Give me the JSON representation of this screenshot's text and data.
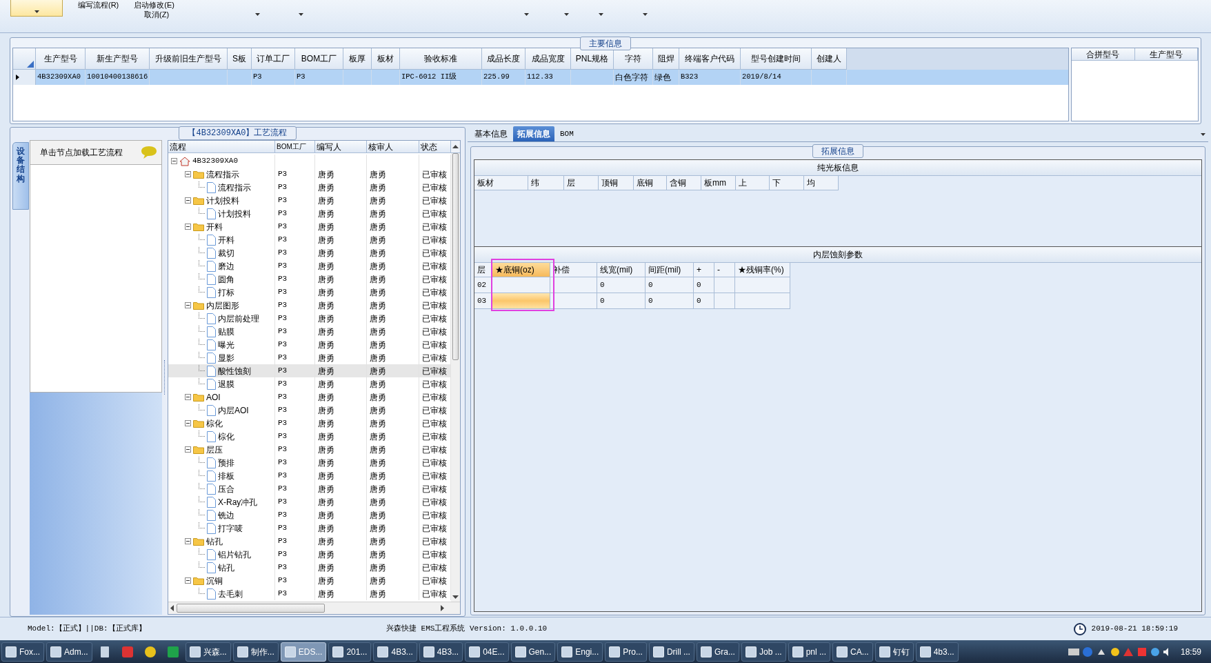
{
  "ribbon": {
    "commands": [
      "编写流程(R)",
      "启动修改(E)",
      "取消(Z)"
    ]
  },
  "main_info": {
    "title": "主要信息",
    "table": {
      "columns": [
        "生产型号",
        "新生产型号",
        "升级前旧生产型号",
        "S板",
        "订单工厂",
        "BOM工厂",
        "板厚",
        "板材",
        "验收标准",
        "成品长度",
        "成品宽度",
        "PNL规格",
        "字符",
        "阻焊",
        "终端客户代码",
        "型号创建时间",
        "创建人"
      ],
      "rows": [
        {
          "selected": true,
          "cells": [
            "4B32309XA0",
            "10010400138616",
            null,
            null,
            "P3",
            "P3",
            null,
            null,
            "IPC-6012 II级",
            "225.99",
            "112.33",
            null,
            "白色字符",
            "绿色",
            "B323",
            "2019/8/14",
            null
          ]
        }
      ]
    },
    "side_table": {
      "columns": [
        "合拼型号",
        "生产型号"
      ]
    }
  },
  "process_panel": {
    "title": "【4B32309XA0】工艺流程",
    "side_tab": "设备结构",
    "hint": "单击节点加载工艺流程",
    "columns": [
      "流程",
      "BOM工厂",
      "编写人",
      "核审人",
      "状态"
    ],
    "tree": {
      "label": "4B32309XA0",
      "kind": "root",
      "expanded": true,
      "selected": false,
      "children": [
        {
          "label": "流程指示",
          "kind": "folder",
          "bom": "P3",
          "writer": "唐勇",
          "reviewer": "唐勇",
          "status": "已审核",
          "expanded": true,
          "selected": false,
          "children": [
            {
              "label": "流程指示",
              "kind": "file",
              "bom": "P3",
              "writer": "唐勇",
              "reviewer": "唐勇",
              "status": "已审核",
              "selected": false
            }
          ]
        },
        {
          "label": "计划投料",
          "kind": "folder",
          "bom": "P3",
          "writer": "唐勇",
          "reviewer": "唐勇",
          "status": "已审核",
          "expanded": true,
          "selected": false,
          "children": [
            {
              "label": "计划投料",
              "kind": "file",
              "bom": "P3",
              "writer": "唐勇",
              "reviewer": "唐勇",
              "status": "已审核",
              "selected": false
            }
          ]
        },
        {
          "label": "开料",
          "kind": "folder",
          "bom": "P3",
          "writer": "唐勇",
          "reviewer": "唐勇",
          "status": "已审核",
          "expanded": true,
          "selected": false,
          "children": [
            {
              "label": "开料",
              "kind": "file",
              "bom": "P3",
              "writer": "唐勇",
              "reviewer": "唐勇",
              "status": "已审核",
              "selected": false
            },
            {
              "label": "裁切",
              "kind": "file",
              "bom": "P3",
              "writer": "唐勇",
              "reviewer": "唐勇",
              "status": "已审核",
              "selected": false
            },
            {
              "label": "磨边",
              "kind": "file",
              "bom": "P3",
              "writer": "唐勇",
              "reviewer": "唐勇",
              "status": "已审核",
              "selected": false
            },
            {
              "label": "圆角",
              "kind": "file",
              "bom": "P3",
              "writer": "唐勇",
              "reviewer": "唐勇",
              "status": "已审核",
              "selected": false
            },
            {
              "label": "打标",
              "kind": "file",
              "bom": "P3",
              "writer": "唐勇",
              "reviewer": "唐勇",
              "status": "已审核",
              "selected": false
            }
          ]
        },
        {
          "label": "内层图形",
          "kind": "folder",
          "bom": "P3",
          "writer": "唐勇",
          "reviewer": "唐勇",
          "status": "已审核",
          "expanded": true,
          "selected": false,
          "children": [
            {
              "label": "内层前处理",
              "kind": "file",
              "bom": "P3",
              "writer": "唐勇",
              "reviewer": "唐勇",
              "status": "已审核",
              "selected": false
            },
            {
              "label": "贴膜",
              "kind": "file",
              "bom": "P3",
              "writer": "唐勇",
              "reviewer": "唐勇",
              "status": "已审核",
              "selected": false
            },
            {
              "label": "曝光",
              "kind": "file",
              "bom": "P3",
              "writer": "唐勇",
              "reviewer": "唐勇",
              "status": "已审核",
              "selected": false
            },
            {
              "label": "显影",
              "kind": "file",
              "bom": "P3",
              "writer": "唐勇",
              "reviewer": "唐勇",
              "status": "已审核",
              "selected": false
            },
            {
              "label": "酸性蚀刻",
              "kind": "file",
              "bom": "P3",
              "writer": "唐勇",
              "reviewer": "唐勇",
              "status": "已审核",
              "selected": true
            },
            {
              "label": "退膜",
              "kind": "file",
              "bom": "P3",
              "writer": "唐勇",
              "reviewer": "唐勇",
              "status": "已审核",
              "selected": false
            }
          ]
        },
        {
          "label": "AOI",
          "kind": "folder",
          "bom": "P3",
          "writer": "唐勇",
          "reviewer": "唐勇",
          "status": "已审核",
          "expanded": true,
          "selected": false,
          "children": [
            {
              "label": "内层AOI",
              "kind": "file",
              "bom": "P3",
              "writer": "唐勇",
              "reviewer": "唐勇",
              "status": "已审核",
              "selected": false
            }
          ]
        },
        {
          "label": "棕化",
          "kind": "folder",
          "bom": "P3",
          "writer": "唐勇",
          "reviewer": "唐勇",
          "status": "已审核",
          "expanded": true,
          "selected": false,
          "children": [
            {
              "label": "棕化",
              "kind": "file",
              "bom": "P3",
              "writer": "唐勇",
              "reviewer": "唐勇",
              "status": "已审核",
              "selected": false
            }
          ]
        },
        {
          "label": "层压",
          "kind": "folder",
          "bom": "P3",
          "writer": "唐勇",
          "reviewer": "唐勇",
          "status": "已审核",
          "expanded": true,
          "selected": false,
          "children": [
            {
              "label": "预排",
              "kind": "file",
              "bom": "P3",
              "writer": "唐勇",
              "reviewer": "唐勇",
              "status": "已审核",
              "selected": false
            },
            {
              "label": "排板",
              "kind": "file",
              "bom": "P3",
              "writer": "唐勇",
              "reviewer": "唐勇",
              "status": "已审核",
              "selected": false
            },
            {
              "label": "压合",
              "kind": "file",
              "bom": "P3",
              "writer": "唐勇",
              "reviewer": "唐勇",
              "status": "已审核",
              "selected": false
            },
            {
              "label": "X-Ray冲孔",
              "kind": "file",
              "bom": "P3",
              "writer": "唐勇",
              "reviewer": "唐勇",
              "status": "已审核",
              "selected": false
            },
            {
              "label": "铣边",
              "kind": "file",
              "bom": "P3",
              "writer": "唐勇",
              "reviewer": "唐勇",
              "status": "已审核",
              "selected": false
            },
            {
              "label": "打字唛",
              "kind": "file",
              "bom": "P3",
              "writer": "唐勇",
              "reviewer": "唐勇",
              "status": "已审核",
              "selected": false
            }
          ]
        },
        {
          "label": "钻孔",
          "kind": "folder",
          "bom": "P3",
          "writer": "唐勇",
          "reviewer": "唐勇",
          "status": "已审核",
          "expanded": true,
          "selected": false,
          "children": [
            {
              "label": "铝片钻孔",
              "kind": "file",
              "bom": "P3",
              "writer": "唐勇",
              "reviewer": "唐勇",
              "status": "已审核",
              "selected": false
            },
            {
              "label": "钻孔",
              "kind": "file",
              "bom": "P3",
              "writer": "唐勇",
              "reviewer": "唐勇",
              "status": "已审核",
              "selected": false
            }
          ]
        },
        {
          "label": "沉铜",
          "kind": "folder",
          "bom": "P3",
          "writer": "唐勇",
          "reviewer": "唐勇",
          "status": "已审核",
          "expanded": true,
          "selected": false,
          "children": [
            {
              "label": "去毛刺",
              "kind": "file",
              "bom": "P3",
              "writer": "唐勇",
              "reviewer": "唐勇",
              "status": "已审核",
              "selected": false
            }
          ]
        }
      ]
    }
  },
  "detail_panel": {
    "tabs": [
      {
        "label": "基本信息",
        "selected": false
      },
      {
        "label": "拓展信息",
        "selected": true
      },
      {
        "label": "BOM",
        "selected": false
      }
    ],
    "group_title": "拓展信息",
    "bare_board": {
      "title": "纯光板信息",
      "columns": [
        "板材",
        "纬",
        "层",
        "顶铜",
        "底铜",
        "含铜",
        "板mm",
        "上",
        "下",
        "均"
      ]
    },
    "inner_etch": {
      "title": "内层蚀刻参数",
      "columns": [
        {
          "label": "层",
          "selected": false
        },
        {
          "label": "★底铜(oz)",
          "selected": true
        },
        {
          "label": "补偿",
          "selected": false
        },
        {
          "label": "线宽(mil)",
          "selected": false
        },
        {
          "label": "间距(mil)",
          "selected": false
        },
        {
          "label": "+",
          "selected": false
        },
        {
          "label": "-",
          "selected": false
        },
        {
          "label": "★残铜率(%)",
          "selected": false
        }
      ],
      "rows": [
        {
          "cells": [
            {
              "text": "02",
              "selected": false
            },
            {
              "selected": false
            },
            {
              "selected": false
            },
            {
              "text": "0",
              "selected": false
            },
            {
              "text": "0",
              "selected": false
            },
            {
              "text": "0",
              "selected": false
            },
            {
              "selected": false
            },
            {
              "selected": false
            }
          ]
        },
        {
          "cells": [
            {
              "text": "03",
              "selected": false
            },
            {
              "selected": true
            },
            {
              "selected": false
            },
            {
              "text": "0",
              "selected": false
            },
            {
              "text": "0",
              "selected": false
            },
            {
              "text": "0",
              "selected": false
            },
            {
              "selected": false
            },
            {
              "selected": false
            }
          ]
        }
      ]
    }
  },
  "status_bar": {
    "left": "Model:【正式】||DB:【正式库】",
    "center": "兴森快捷 EMS工程系统 Version: 1.0.0.10",
    "datetime": "2019-08-21 18:59:19"
  },
  "taskbar": {
    "items": [
      {
        "label": "Fox...",
        "selected": false
      },
      {
        "label": "Adm...",
        "selected": false
      },
      {
        "label": "兴森...",
        "selected": false
      },
      {
        "label": "制作...",
        "selected": false
      },
      {
        "label": "EDS...",
        "selected": true
      },
      {
        "label": "201...",
        "selected": false
      },
      {
        "label": "4B3...",
        "selected": false
      },
      {
        "label": "4B3...",
        "selected": false
      },
      {
        "label": "04E...",
        "selected": false
      },
      {
        "label": "Gen...",
        "selected": false
      },
      {
        "label": "Engi...",
        "selected": false
      },
      {
        "label": "Pro...",
        "selected": false
      },
      {
        "label": "Drill ...",
        "selected": false
      },
      {
        "label": "Gra...",
        "selected": false
      },
      {
        "label": "Job ...",
        "selected": false
      },
      {
        "label": "pnl ...",
        "selected": false
      },
      {
        "label": "CA...",
        "selected": false
      },
      {
        "label": "钉钉",
        "selected": false
      },
      {
        "label": "4b3...",
        "selected": false
      }
    ],
    "clock": "18:59"
  }
}
